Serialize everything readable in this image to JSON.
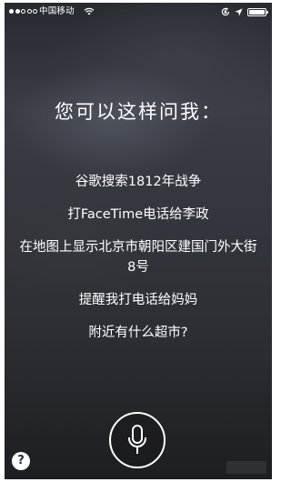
{
  "status_bar": {
    "signal_dots_filled": 2,
    "signal_dots_total": 5,
    "carrier": "中国移动",
    "wifi_icon": "wifi-icon",
    "rotation_lock_icon": "rotation-lock-icon",
    "location_icon": "location-arrow-icon",
    "battery_level": 1.0
  },
  "siri": {
    "title": "您可以这样问我：",
    "suggestions": [
      "谷歌搜索1812年战争",
      "打FaceTime电话给李政",
      "在地图上显示北京市朝阳区建国门外大街8号",
      "提醒我打电话给妈妈",
      "附近有什么超市?"
    ],
    "mic_icon": "microphone-icon",
    "help_label": "?"
  },
  "colors": {
    "text": "#ffffff",
    "background": "#2f3237"
  }
}
